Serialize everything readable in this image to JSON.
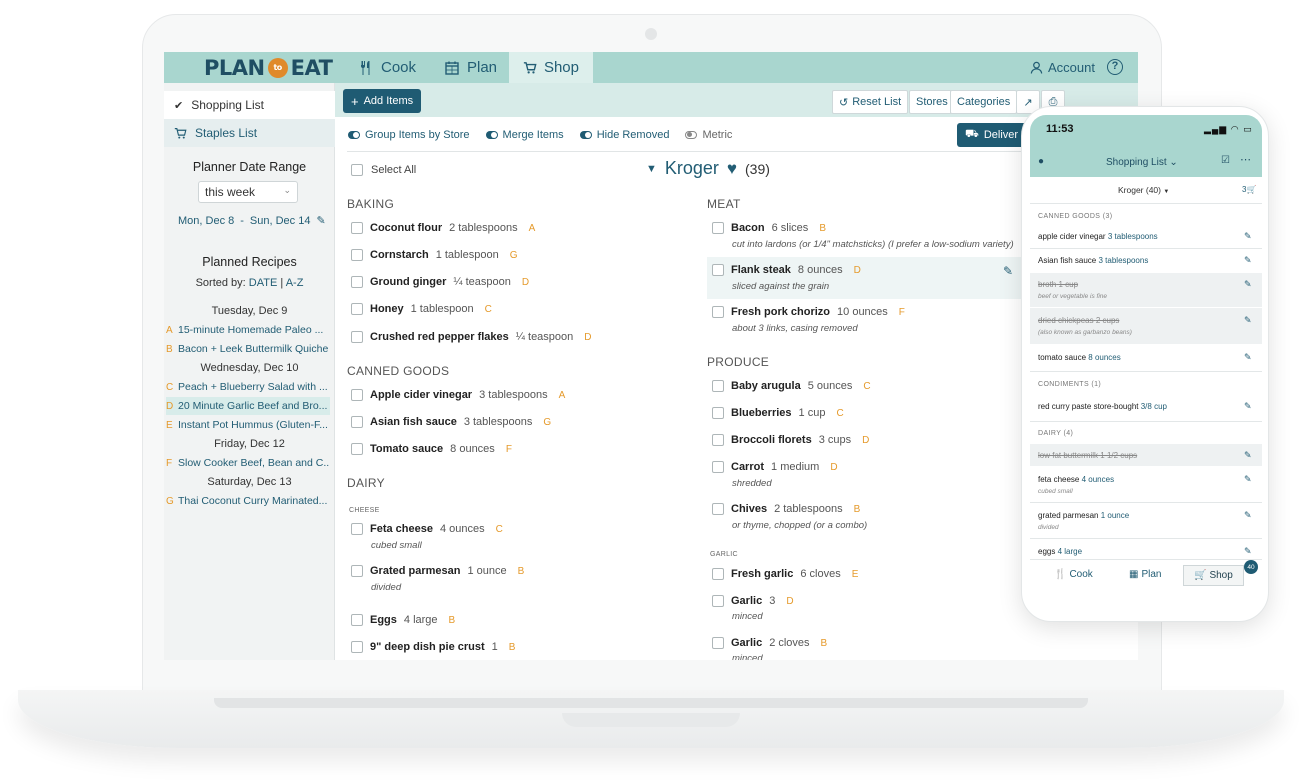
{
  "nav": {
    "logo_plan": "PLAN",
    "logo_to": "to",
    "logo_eat": "EAT",
    "cook": "Cook",
    "plan": "Plan",
    "shop": "Shop",
    "account": "Account",
    "help": "?"
  },
  "sidebar": {
    "shopping_list": "Shopping List",
    "staples_list": "Staples List",
    "date_range_title": "Planner Date Range",
    "range_select": "this week",
    "date_start": "Mon, Dec 8",
    "date_sep": "-",
    "date_end": "Sun, Dec 14",
    "planned_title": "Planned Recipes",
    "sorted_by": "Sorted by:",
    "sort_date": "DATE",
    "sort_sep": "|",
    "sort_az": "A-Z",
    "days": [
      {
        "label": "Tuesday, Dec 9"
      },
      {
        "label": "Wednesday, Dec 10"
      },
      {
        "label": "Friday, Dec 12"
      },
      {
        "label": "Saturday, Dec 13"
      }
    ],
    "recipes": [
      {
        "letter": "A",
        "name": "15-minute Homemade Paleo ..."
      },
      {
        "letter": "B",
        "name": "Bacon + Leek Buttermilk Quiche"
      },
      {
        "letter": "C",
        "name": "Peach + Blueberry Salad with ..."
      },
      {
        "letter": "D",
        "name": "20 Minute Garlic Beef and Bro..."
      },
      {
        "letter": "E",
        "name": "Instant Pot Hummus (Gluten-F..."
      },
      {
        "letter": "F",
        "name": "Slow Cooker Beef, Bean and C..."
      },
      {
        "letter": "G",
        "name": "Thai Coconut Curry Marinated..."
      }
    ]
  },
  "toolbar": {
    "add_items": "Add Items",
    "reset_list": "Reset List",
    "stores": "Stores",
    "categories": "Categories",
    "group_by_store": "Group Items by Store",
    "merge_items": "Merge Items",
    "hide_removed": "Hide Removed",
    "metric": "Metric",
    "deliver": "Deliver G"
  },
  "list": {
    "select_all": "Select All",
    "store_name": "Kroger",
    "store_count": "(39)",
    "left": {
      "baking": "BAKING",
      "baking_items": [
        {
          "name": "Coconut flour",
          "qty": "2 tablespoons",
          "letter": "A"
        },
        {
          "name": "Cornstarch",
          "qty": "1 tablespoon",
          "letter": "G"
        },
        {
          "name": "Ground ginger",
          "qty": "¼ teaspoon",
          "letter": "D"
        },
        {
          "name": "Honey",
          "qty": "1 tablespoon",
          "letter": "C"
        },
        {
          "name": "Crushed red pepper flakes",
          "qty": "¼ teaspoon",
          "letter": "D"
        }
      ],
      "canned": "CANNED GOODS",
      "canned_items": [
        {
          "name": "Apple cider vinegar",
          "qty": "3 tablespoons",
          "letter": "A"
        },
        {
          "name": "Asian fish sauce",
          "qty": "3 tablespoons",
          "letter": "G"
        },
        {
          "name": "Tomato sauce",
          "qty": "8 ounces",
          "letter": "F"
        }
      ],
      "dairy": "DAIRY",
      "cheese": "CHEESE",
      "dairy_items": [
        {
          "name": "Feta cheese",
          "qty": "4 ounces",
          "letter": "C",
          "note": "cubed small"
        },
        {
          "name": "Grated parmesan",
          "qty": "1 ounce",
          "letter": "B",
          "note": "divided"
        },
        {
          "name": "Eggs",
          "qty": "4 large",
          "letter": "B"
        },
        {
          "name": "9\" deep dish pie crust",
          "qty": "1",
          "letter": "B"
        }
      ]
    },
    "right": {
      "meat": "MEAT",
      "meat_items": [
        {
          "name": "Bacon",
          "qty": "6 slices",
          "letter": "B",
          "note": "cut into lardons (or 1/4\" matchsticks) (I prefer a low-sodium variety)"
        },
        {
          "name": "Flank steak",
          "qty": "8 ounces",
          "letter": "D",
          "note": "sliced against the grain"
        },
        {
          "name": "Fresh pork chorizo",
          "qty": "10 ounces",
          "letter": "F",
          "note": "about 3 links, casing removed"
        }
      ],
      "produce": "PRODUCE",
      "produce_items": [
        {
          "name": "Baby arugula",
          "qty": "5 ounces",
          "letter": "C"
        },
        {
          "name": "Blueberries",
          "qty": "1 cup",
          "letter": "C"
        },
        {
          "name": "Broccoli florets",
          "qty": "3 cups",
          "letter": "D"
        },
        {
          "name": "Carrot",
          "qty": "1 medium",
          "letter": "D",
          "note": "shredded"
        },
        {
          "name": "Chives",
          "qty": "2 tablespoons",
          "letter": "B",
          "note": "or thyme, chopped (or a combo)"
        }
      ],
      "garlic": "GARLIC",
      "garlic_items": [
        {
          "name": "Fresh garlic",
          "qty": "6 cloves",
          "letter": "E"
        },
        {
          "name": "Garlic",
          "qty": "3",
          "letter": "D",
          "note": "minced"
        },
        {
          "name": "Garlic",
          "qty": "2 cloves",
          "letter": "B",
          "note": "minced"
        }
      ]
    }
  },
  "phone": {
    "time": "11:53",
    "title": "Shopping List",
    "store": "Kroger (40)",
    "cart_count": "3",
    "canned_cat": "CANNED GOODS (3)",
    "condiments_cat": "CONDIMENTS (1)",
    "dairy_cat": "DAIRY (4)",
    "items": [
      {
        "name": "apple cider vinegar",
        "qty": "3 tablespoons"
      },
      {
        "name": "Asian fish sauce",
        "qty": "3 tablespoons"
      },
      {
        "name": "broth",
        "qty": "1 cup",
        "note": "beef or vegetable is fine"
      },
      {
        "name": "dried chickpeas",
        "qty": "2 cups",
        "note": "(also known as garbanzo beans)"
      },
      {
        "name": "tomato sauce",
        "qty": "8 ounces"
      },
      {
        "name": "red curry paste store-bought",
        "qty": "3/8 cup"
      },
      {
        "name": "low fat buttermilk",
        "qty": "1 1/2 cups"
      },
      {
        "name": "feta cheese",
        "qty": "4 ounces",
        "note": "cubed small"
      },
      {
        "name": "grated parmesan",
        "qty": "1 ounce",
        "note": "divided"
      },
      {
        "name": "eggs",
        "qty": "4 large"
      }
    ],
    "tab_cook": "Cook",
    "tab_plan": "Plan",
    "tab_shop": "Shop",
    "badge": "40"
  },
  "colors": {
    "brand_teal": "#a9d6cf",
    "brand_navy": "#1f5b73",
    "recipe_letter": "#e59a2b"
  }
}
